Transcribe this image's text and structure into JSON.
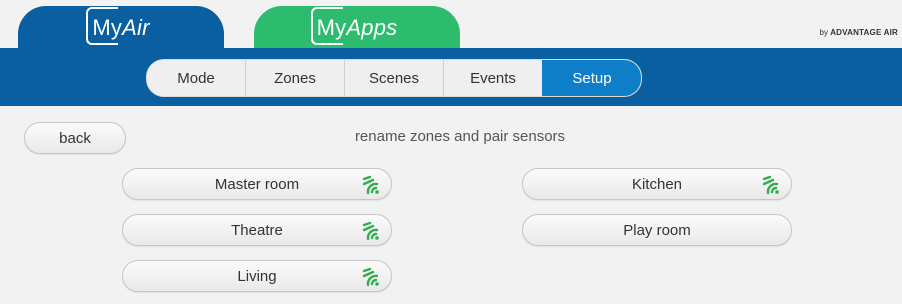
{
  "header": {
    "tabs": [
      {
        "logo_my": "My",
        "logo_rest": "Air",
        "color": "#0a5fa0"
      },
      {
        "logo_my": "My",
        "logo_rest": "Apps",
        "color": "#2dbb6e"
      }
    ],
    "brand_prefix": "by ",
    "brand_name": "ADVANTAGE AIR"
  },
  "nav": {
    "segments": [
      "Mode",
      "Zones",
      "Scenes",
      "Events",
      "Setup"
    ],
    "active": "Setup",
    "accent": "#0f7ec9"
  },
  "page": {
    "back_label": "back",
    "subtitle": "rename zones and pair sensors"
  },
  "zones": [
    {
      "name": "Master room",
      "sensor_icon": "wireless-sensor-icon",
      "paired": true
    },
    {
      "name": "Theatre",
      "sensor_icon": "wireless-sensor-icon",
      "paired": true
    },
    {
      "name": "Living",
      "sensor_icon": "wireless-sensor-icon",
      "paired": true
    },
    {
      "name": "Kitchen",
      "sensor_icon": "wireless-sensor-icon",
      "paired": true
    },
    {
      "name": "Play room",
      "paired": false
    }
  ],
  "colors": {
    "sensor_green": "#2fae4e",
    "band_blue": "#0a5fa0"
  }
}
